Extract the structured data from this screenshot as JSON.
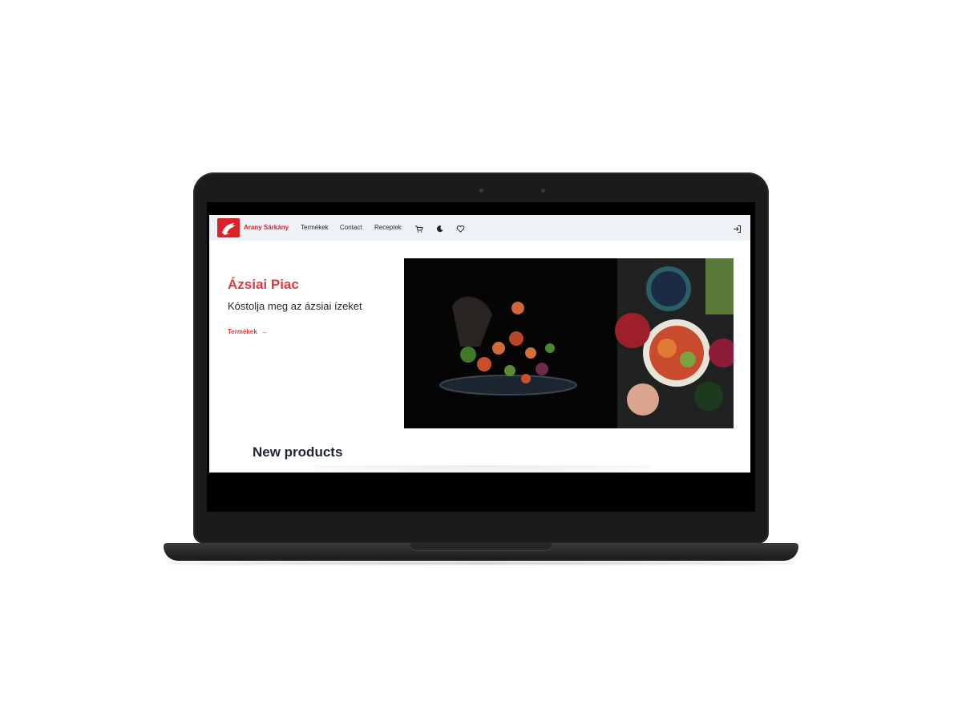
{
  "header": {
    "brand": "Arany Sárkány",
    "nav": [
      {
        "label": "Termékek"
      },
      {
        "label": "Contact"
      },
      {
        "label": "Receptek"
      }
    ],
    "icons": [
      "cart-icon",
      "moon-icon",
      "heart-icon",
      "login-icon"
    ]
  },
  "hero": {
    "title": "Ázsiai Piac",
    "subtitle": "Kóstolja meg az ázsiai ízeket",
    "cta_label": "Termékek",
    "cta_arrow": "→"
  },
  "sections": {
    "new_products_title": "New products"
  },
  "colors": {
    "accent": "#e0393e",
    "nav_bg": "#eef2f6",
    "text": "#1e2530",
    "laptop": "#1b1b1b"
  }
}
